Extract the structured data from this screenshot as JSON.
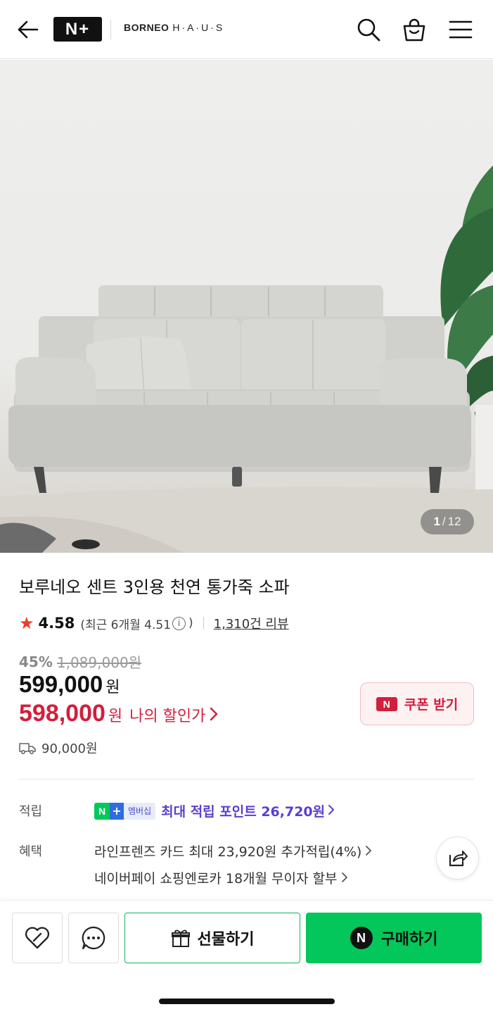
{
  "header": {
    "logo_text": "N+",
    "brand_bold": "BORNEO",
    "brand_light": "H·A·U·S",
    "icons": [
      "back-arrow-icon",
      "search-icon",
      "shopping-bag-icon",
      "menu-icon"
    ]
  },
  "gallery": {
    "current": "1",
    "separator": "/",
    "total": "12"
  },
  "product": {
    "title": "보루네오 센트 3인용 천연 통가죽 소파",
    "rating": "4.58",
    "recent_rating_prefix": "(최근 6개월 4.51",
    "recent_rating_suffix": ")",
    "review_count": "1,310건 리뷰",
    "discount_pct": "45%",
    "original_price": "1,089,000원",
    "price": "599,000",
    "price_unit": "원",
    "my_price": "598,000",
    "my_price_unit": "원",
    "my_price_label": "나의 할인가",
    "delivery_fee": "90,000원"
  },
  "coupon": {
    "badge": "N",
    "label": "쿠폰 받기"
  },
  "points": {
    "label": "적립",
    "badge_n": "N",
    "badge_plus": "+",
    "badge_text": "멤버십",
    "text": "최대 적립 포인트 26,720원"
  },
  "benefits": {
    "label": "혜택",
    "line1": "라인프렌즈 카드 최대 23,920원 추가적립(4%)",
    "line2": "네이버페이 쇼핑엔로카 18개월 무이자 할부"
  },
  "bottom": {
    "gift_label": "선물하기",
    "buy_badge": "N",
    "buy_label": "구매하기"
  },
  "colors": {
    "naver_green": "#03c75a",
    "sale_red": "#d21f3c",
    "points_purple": "#5a3fcf"
  }
}
